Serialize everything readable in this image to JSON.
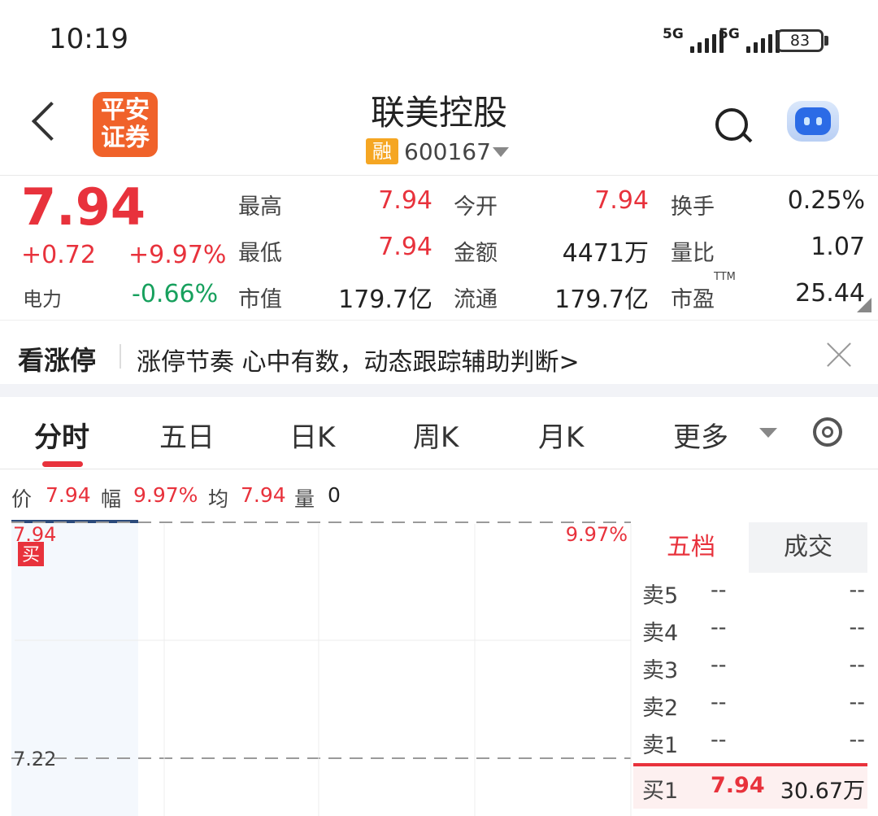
{
  "status_bar": {
    "time": "10:19",
    "sim1": "5G",
    "sim2": "5G",
    "battery": "83",
    "icons": [
      "signal-icon",
      "battery-icon"
    ]
  },
  "header": {
    "broker_logo_line1": "平安",
    "broker_logo_line2": "证券",
    "stock_name": "联美控股",
    "margin_badge": "融",
    "stock_code": "600167"
  },
  "quote": {
    "last_price": "7.94",
    "change": "+0.72",
    "change_pct": "+9.97%",
    "sector_name": "电力",
    "sector_pct": "-0.66%",
    "fields": {
      "high_label": "最高",
      "high_value": "7.94",
      "open_label": "今开",
      "open_value": "7.94",
      "turnover_label": "换手",
      "turnover_value": "0.25%",
      "low_label": "最低",
      "low_value": "7.94",
      "amount_label": "金额",
      "amount_value": "4471万",
      "volratio_label": "量比",
      "volratio_value": "1.07",
      "mktcap_label": "市值",
      "mktcap_value": "179.7亿",
      "float_label": "流通",
      "float_value": "179.7亿",
      "pe_label": "市盈",
      "pe_sup": "TTM",
      "pe_value": "25.44"
    }
  },
  "banner": {
    "title": "看涨停",
    "text": "涨停节奏 心中有数，动态跟踪辅助判断>"
  },
  "tabs": [
    "分时",
    "五日",
    "日K",
    "周K",
    "月K",
    "更多"
  ],
  "info_line": {
    "price_label": "价",
    "price_value": "7.94",
    "range_label": "幅",
    "range_value": "9.97%",
    "avg_label": "均",
    "avg_value": "7.94",
    "vol_label": "量",
    "vol_value": "0"
  },
  "chart": {
    "top_price": "7.94",
    "top_pct": "9.97%",
    "mid_price": "7.22",
    "buy_marker": "买"
  },
  "orderbook": {
    "tab_depth": "五档",
    "tab_trades": "成交",
    "asks": [
      {
        "label": "卖5",
        "price": "--",
        "volume": "--"
      },
      {
        "label": "卖4",
        "price": "--",
        "volume": "--"
      },
      {
        "label": "卖3",
        "price": "--",
        "volume": "--"
      },
      {
        "label": "卖2",
        "price": "--",
        "volume": "--"
      },
      {
        "label": "卖1",
        "price": "--",
        "volume": "--"
      }
    ],
    "bids": [
      {
        "label": "买1",
        "price": "7.94",
        "volume": "30.67万"
      }
    ]
  },
  "colors": {
    "up": "#e8323c",
    "down": "#17a05d",
    "margin_badge": "#f5a623",
    "broker_logo": "#f0622a"
  }
}
